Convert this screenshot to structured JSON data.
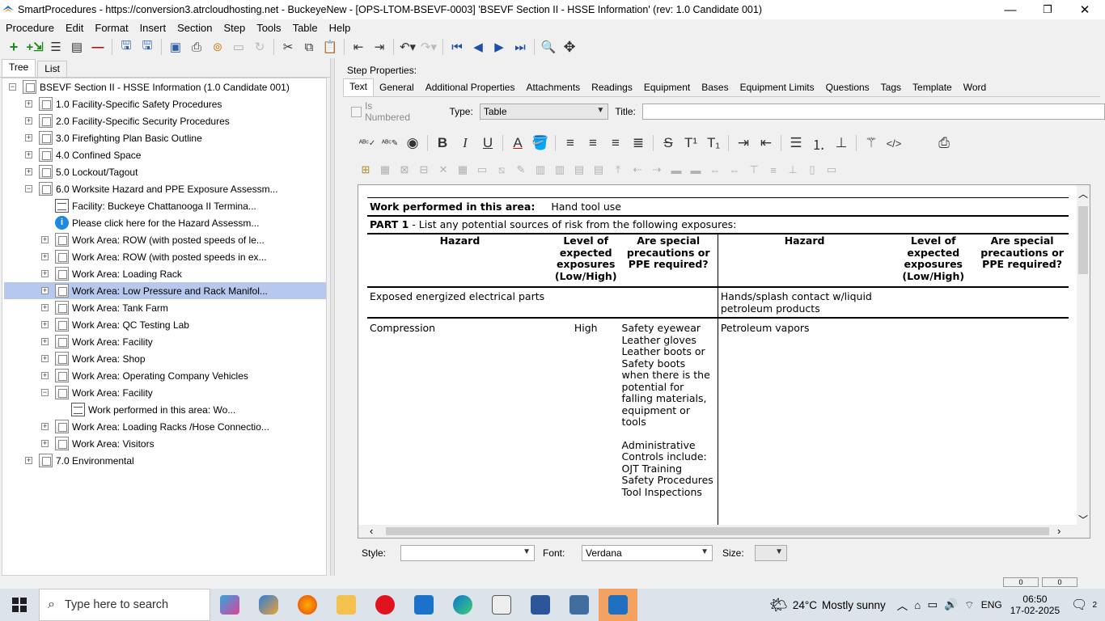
{
  "window": {
    "title": "SmartProcedures - https://conversion3.atrcloudhosting.net - BuckeyeNew - [OPS-LTOM-BSEVF-0003] 'BSEVF Section II - HSSE Information' (rev: 1.0 Candidate 001)",
    "minimize": "—",
    "restore": "❐",
    "close": "✕"
  },
  "menu": [
    "Procedure",
    "Edit",
    "Format",
    "Insert",
    "Section",
    "Step",
    "Tools",
    "Table",
    "Help"
  ],
  "left_tabs": [
    "Tree",
    "List"
  ],
  "tree": [
    {
      "label": "BSEVF Section II - HSSE Information (1.0 Candidate 001)",
      "exp": "−",
      "icon": "book",
      "level": 0
    },
    {
      "label": "1.0 Facility-Specific Safety Procedures",
      "exp": "+",
      "icon": "book",
      "level": 1
    },
    {
      "label": "2.0 Facility-Specific Security Procedures",
      "exp": "+",
      "icon": "book",
      "level": 1
    },
    {
      "label": "3.0 Firefighting Plan Basic Outline",
      "exp": "+",
      "icon": "book",
      "level": 1
    },
    {
      "label": "4.0 Confined Space",
      "exp": "+",
      "icon": "book",
      "level": 1
    },
    {
      "label": "5.0 Lockout/Tagout",
      "exp": "+",
      "icon": "book",
      "level": 1
    },
    {
      "label": "6.0 Worksite Hazard and PPE Exposure Assessm...",
      "exp": "−",
      "icon": "book",
      "level": 1
    },
    {
      "label": "Facility: Buckeye Chattanooga II Termina...",
      "exp": "",
      "icon": "step",
      "level": 2
    },
    {
      "label": "Please click here for the Hazard Assessm...",
      "exp": "",
      "icon": "info",
      "level": 2
    },
    {
      "label": "Work Area: ROW (with posted speeds of le...",
      "exp": "+",
      "icon": "book",
      "level": 2
    },
    {
      "label": "Work Area: ROW (with posted speeds in ex...",
      "exp": "+",
      "icon": "book",
      "level": 2
    },
    {
      "label": "Work Area: Loading Rack",
      "exp": "+",
      "icon": "book",
      "level": 2
    },
    {
      "label": "Work Area: Low Pressure and Rack Manifol...",
      "exp": "+",
      "icon": "book",
      "level": 2,
      "selected": true
    },
    {
      "label": "Work Area: Tank Farm",
      "exp": "+",
      "icon": "book",
      "level": 2
    },
    {
      "label": "Work Area: QC Testing Lab",
      "exp": "+",
      "icon": "book",
      "level": 2
    },
    {
      "label": "Work Area: Facility",
      "exp": "+",
      "icon": "book",
      "level": 2
    },
    {
      "label": "Work Area: Shop",
      "exp": "+",
      "icon": "book",
      "level": 2
    },
    {
      "label": "Work Area: Operating Company Vehicles",
      "exp": "+",
      "icon": "book",
      "level": 2
    },
    {
      "label": "Work Area: Facility",
      "exp": "−",
      "icon": "book",
      "level": 2
    },
    {
      "label": "Work performed in this area:       Wo...",
      "exp": "",
      "icon": "step",
      "level": 3
    },
    {
      "label": "Work Area: Loading Racks /Hose Connectio...",
      "exp": "+",
      "icon": "book",
      "level": 2
    },
    {
      "label": "Work Area: Visitors",
      "exp": "+",
      "icon": "book",
      "level": 2
    },
    {
      "label": "7.0 Environmental",
      "exp": "+",
      "icon": "book",
      "level": 1
    }
  ],
  "step_properties": {
    "label": "Step Properties:",
    "tabs": [
      "Text",
      "General",
      "Additional Properties",
      "Attachments",
      "Readings",
      "Equipment",
      "Bases",
      "Equipment Limits",
      "Questions",
      "Tags",
      "Template",
      "Word"
    ],
    "is_numbered": "Is Numbered",
    "type_label": "Type:",
    "type_value": "Table",
    "title_label": "Title:",
    "title_value": ""
  },
  "document": {
    "work_label": "Work performed in this area:",
    "work_value": "Hand tool use",
    "part1_bold": "PART 1",
    "part1_text": " - List any potential sources of risk from the following exposures:",
    "headers": {
      "hazard": "Hazard",
      "level": "Level of expected exposures (Low/High)",
      "precautions": "Are special precautions or PPE required?"
    },
    "row1": {
      "left_hazard": "Exposed energized electrical parts",
      "right_hazard": "Hands/splash contact w/liquid petroleum products"
    },
    "row2": {
      "left_hazard": "Compression",
      "left_level": "High",
      "left_precautions": "Safety eyewear Leather gloves Leather boots or Safety boots when there is the potential for falling materials, equipment or tools",
      "left_admin": "Administrative Controls include: OJT Training Safety Procedures Tool Inspections",
      "right_hazard": "Petroleum vapors"
    }
  },
  "bottom": {
    "style_label": "Style:",
    "style_value": "",
    "font_label": "Font:",
    "font_value": "Verdana",
    "size_label": "Size:",
    "size_value": ""
  },
  "status": {
    "pos1": "0",
    "pos2": "0"
  },
  "taskbar": {
    "search_placeholder": "Type here to search",
    "weather_temp": "24°C",
    "weather_text": "Mostly sunny",
    "lang": "ENG",
    "time": "06:50",
    "date": "17-02-2025",
    "notif_count": "2"
  }
}
